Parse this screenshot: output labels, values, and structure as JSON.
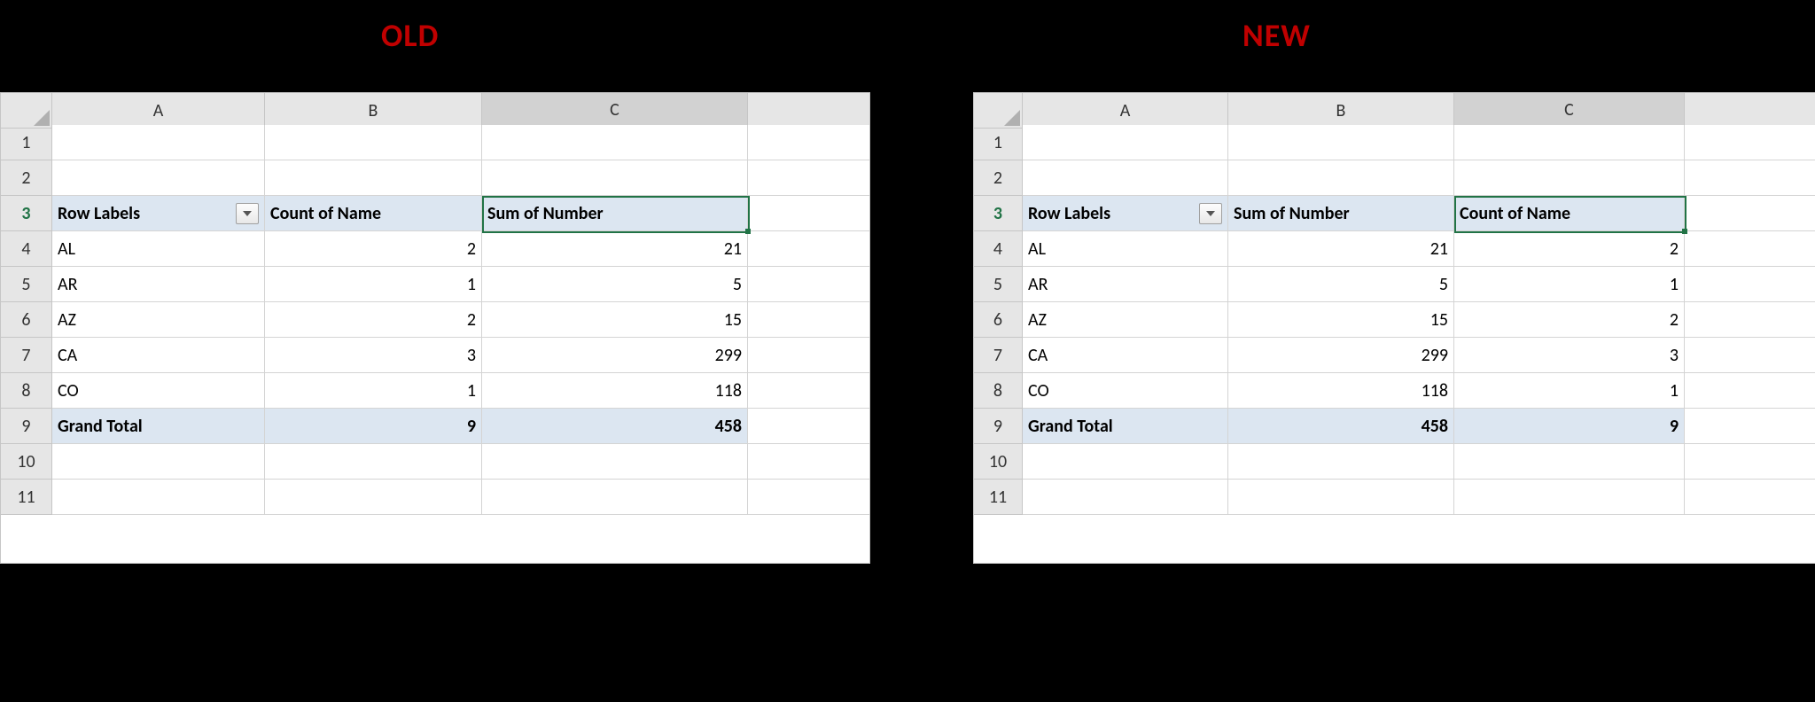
{
  "labels": {
    "old": "OLD",
    "new": "NEW"
  },
  "columns": [
    "A",
    "B",
    "C"
  ],
  "row_numbers": [
    1,
    2,
    3,
    4,
    5,
    6,
    7,
    8,
    9,
    10,
    11
  ],
  "old": {
    "headers": {
      "rowlabels": "Row Labels",
      "col_b": "Count of Name",
      "col_c": "Sum of Number"
    },
    "rows": [
      {
        "a": "AL",
        "b": "2",
        "c": "21"
      },
      {
        "a": "AR",
        "b": "1",
        "c": "5"
      },
      {
        "a": "AZ",
        "b": "2",
        "c": "15"
      },
      {
        "a": "CA",
        "b": "3",
        "c": "299"
      },
      {
        "a": "CO",
        "b": "1",
        "c": "118"
      }
    ],
    "total": {
      "label": "Grand Total",
      "b": "9",
      "c": "458"
    },
    "active_cell": "C3"
  },
  "new": {
    "headers": {
      "rowlabels": "Row Labels",
      "col_b": "Sum of Number",
      "col_c": "Count of Name"
    },
    "rows": [
      {
        "a": "AL",
        "b": "21",
        "c": "2"
      },
      {
        "a": "AR",
        "b": "5",
        "c": "1"
      },
      {
        "a": "AZ",
        "b": "15",
        "c": "2"
      },
      {
        "a": "CA",
        "b": "299",
        "c": "3"
      },
      {
        "a": "CO",
        "b": "118",
        "c": "1"
      }
    ],
    "total": {
      "label": "Grand Total",
      "b": "458",
      "c": "9"
    },
    "active_cell": "C3"
  },
  "chart_data": {
    "type": "table",
    "title": "Pivot table column reorder comparison",
    "tables": [
      {
        "name": "OLD",
        "columns": [
          "Row Labels",
          "Count of Name",
          "Sum of Number"
        ],
        "rows": [
          [
            "AL",
            2,
            21
          ],
          [
            "AR",
            1,
            5
          ],
          [
            "AZ",
            2,
            15
          ],
          [
            "CA",
            3,
            299
          ],
          [
            "CO",
            1,
            118
          ]
        ],
        "grand_total": [
          "Grand Total",
          9,
          458
        ]
      },
      {
        "name": "NEW",
        "columns": [
          "Row Labels",
          "Sum of Number",
          "Count of Name"
        ],
        "rows": [
          [
            "AL",
            21,
            2
          ],
          [
            "AR",
            5,
            1
          ],
          [
            "AZ",
            15,
            2
          ],
          [
            "CA",
            299,
            3
          ],
          [
            "CO",
            118,
            1
          ]
        ],
        "grand_total": [
          "Grand Total",
          458,
          9
        ]
      }
    ]
  }
}
